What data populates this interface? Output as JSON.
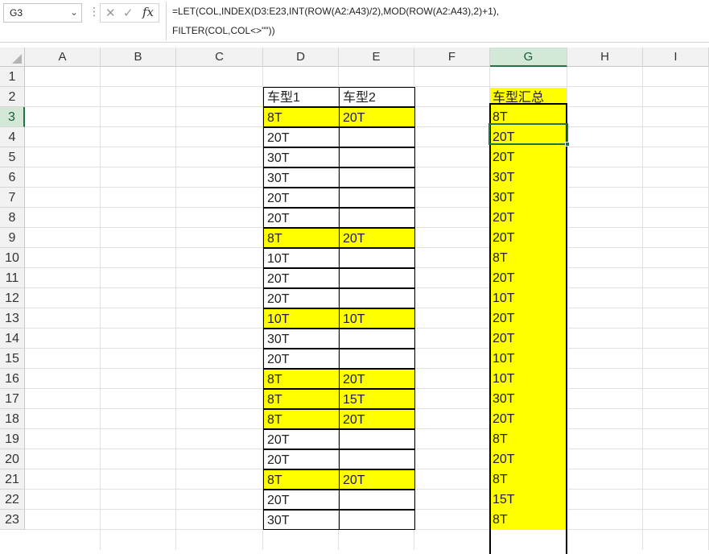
{
  "formula_bar": {
    "name_box": "G3",
    "name_box_arrow_icon": "chevron-down-icon",
    "cancel_icon": "close-icon",
    "enter_icon": "checkmark-icon",
    "fx_label": "fx",
    "formula_line1": "=LET(COL,INDEX(D3:E23,INT(ROW(A2:A43)/2),MOD(ROW(A2:A43),2)+1),",
    "formula_line2": "FILTER(COL,COL<>\"\"))"
  },
  "columns": [
    "A",
    "B",
    "C",
    "D",
    "E",
    "F",
    "G",
    "H",
    "I"
  ],
  "selected_column": "G",
  "rows": [
    "1",
    "2",
    "3",
    "4",
    "5",
    "6",
    "7",
    "8",
    "9",
    "10",
    "11",
    "12",
    "13",
    "14",
    "15",
    "16",
    "17",
    "18",
    "19",
    "20",
    "21",
    "22",
    "23"
  ],
  "selected_row": "3",
  "table": {
    "header_d": "车型1",
    "header_e": "车型2",
    "col_d": [
      "8T",
      "20T",
      "30T",
      "30T",
      "20T",
      "20T",
      "8T",
      "10T",
      "20T",
      "20T",
      "10T",
      "30T",
      "20T",
      "8T",
      "8T",
      "8T",
      "20T",
      "20T",
      "8T",
      "20T",
      "30T"
    ],
    "col_e": [
      "20T",
      "",
      "",
      "",
      "",
      "",
      "20T",
      "",
      "",
      "",
      "10T",
      "",
      "",
      "20T",
      "15T",
      "20T",
      "",
      "",
      "20T",
      "",
      ""
    ],
    "highlight_rows": [
      3,
      9,
      13,
      16,
      17,
      18,
      21
    ]
  },
  "summary": {
    "header": "车型汇总",
    "values": [
      "8T",
      "20T",
      "20T",
      "30T",
      "30T",
      "20T",
      "20T",
      "8T",
      "20T",
      "10T",
      "20T",
      "20T",
      "10T",
      "10T",
      "30T",
      "20T",
      "8T",
      "20T",
      "8T",
      "15T",
      "8T"
    ]
  },
  "colors": {
    "highlight": "#ffff00",
    "selection": "#217346"
  }
}
